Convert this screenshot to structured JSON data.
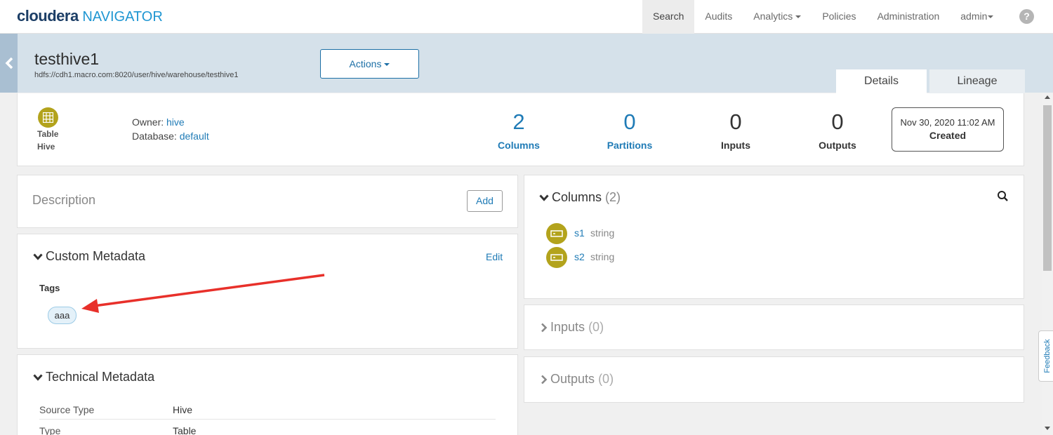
{
  "brand": {
    "name": "cloudera",
    "product": "NAVIGATOR"
  },
  "nav": {
    "search": "Search",
    "audits": "Audits",
    "analytics": "Analytics",
    "policies": "Policies",
    "administration": "Administration",
    "user": "admin",
    "help_glyph": "?"
  },
  "entity": {
    "name": "testhive1",
    "path": "hdfs://cdh1.macro.com:8020/user/hive/warehouse/testhive1",
    "actions_label": "Actions",
    "type": "Table",
    "source": "Hive"
  },
  "tabs": {
    "details": "Details",
    "lineage": "Lineage"
  },
  "owner": {
    "label": "Owner:",
    "value": "hive"
  },
  "database": {
    "label": "Database:",
    "value": "default"
  },
  "stats": {
    "columns": {
      "value": "2",
      "label": "Columns"
    },
    "partitions": {
      "value": "0",
      "label": "Partitions"
    },
    "inputs": {
      "value": "0",
      "label": "Inputs"
    },
    "outputs": {
      "value": "0",
      "label": "Outputs"
    }
  },
  "created": {
    "date": "Nov 30, 2020 11:02 AM",
    "label": "Created"
  },
  "description": {
    "title": "Description",
    "add_label": "Add"
  },
  "custom_metadata": {
    "title": "Custom Metadata",
    "edit_label": "Edit",
    "tags_label": "Tags",
    "tags": [
      "aaa"
    ]
  },
  "technical_metadata": {
    "title": "Technical Metadata",
    "rows": [
      {
        "key": "Source Type",
        "value": "Hive"
      },
      {
        "key": "Type",
        "value": "Table"
      }
    ]
  },
  "columns_panel": {
    "title": "Columns",
    "count": "(2)",
    "items": [
      {
        "name": "s1",
        "type": "string"
      },
      {
        "name": "s2",
        "type": "string"
      }
    ]
  },
  "inputs_panel": {
    "title": "Inputs",
    "count": "(0)"
  },
  "outputs_panel": {
    "title": "Outputs",
    "count": "(0)"
  },
  "feedback": "Feedback",
  "colors": {
    "accent_blue": "#1f7bb6",
    "brand_navy": "#1c3e66",
    "entity_icon": "#b3a31c",
    "header_band": "#d5e1ea",
    "annotation_arrow": "#e8302a"
  }
}
